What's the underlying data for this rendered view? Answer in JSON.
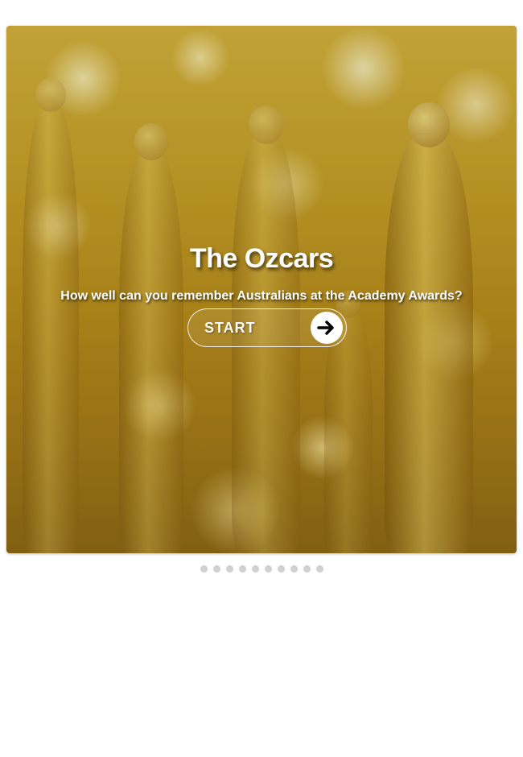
{
  "quiz": {
    "title": "The Ozcars",
    "subtitle": "How well can you remember Australians at the Academy Awards?",
    "start_label": "START",
    "start_icon": "arrow-right-icon"
  },
  "pagination": {
    "total_pages": 10,
    "active_page": 1
  },
  "colors": {
    "accent_gold": "#c9a22a",
    "text": "#ffffff",
    "dot": "#d0d0d0"
  }
}
